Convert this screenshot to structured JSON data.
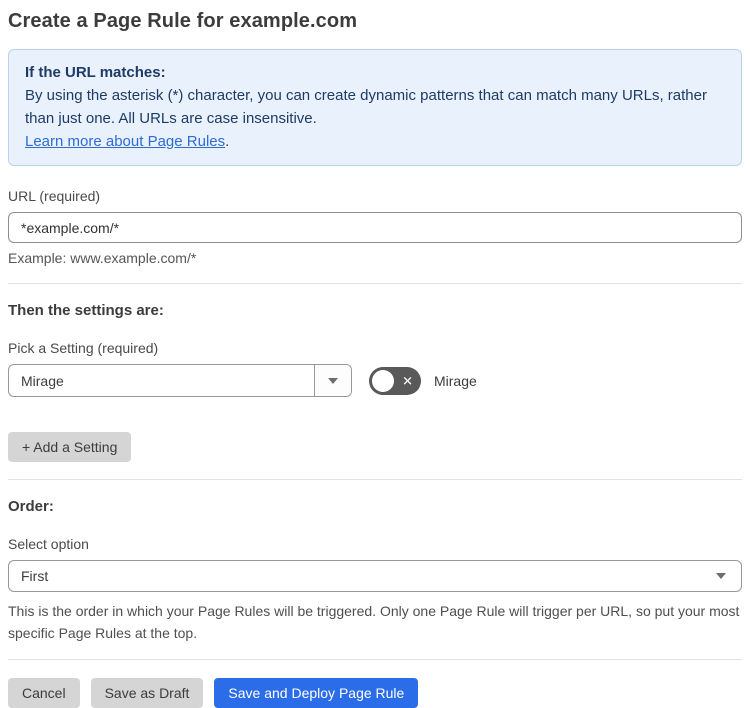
{
  "page": {
    "title": "Create a Page Rule for example.com"
  },
  "info_box": {
    "heading": "If the URL matches:",
    "body": "By using the asterisk (*) character, you can create dynamic patterns that can match many URLs, rather than just one. All URLs are case insensitive.",
    "link_label": "Learn more about Page Rules",
    "link_suffix": "."
  },
  "url_field": {
    "label": "URL (required)",
    "value": "*example.com/*",
    "example": "Example: www.example.com/*"
  },
  "settings": {
    "heading": "Then the settings are:",
    "picker_label": "Pick a Setting (required)",
    "selected_setting": "Mirage",
    "toggle": {
      "state": "off",
      "label": "Mirage",
      "off_icon": "✕"
    },
    "add_button_label": "+ Add a Setting"
  },
  "order": {
    "heading": "Order:",
    "select_label": "Select option",
    "selected_option": "First",
    "help_text": "This is the order in which your Page Rules will be triggered. Only one Page Rule will trigger per URL, so put your most specific Page Rules at the top."
  },
  "actions": {
    "cancel_label": "Cancel",
    "save_draft_label": "Save as Draft",
    "save_deploy_label": "Save and Deploy Page Rule"
  },
  "colors": {
    "accent_blue": "#2b6ce8",
    "info_background": "#e9f2fc",
    "info_border": "#b7d4ee",
    "info_text": "#1e3a66",
    "link_blue": "#2e6bd4",
    "toggle_off": "#595959",
    "button_gray": "#d5d5d5",
    "divider": "#e3e3e3"
  }
}
